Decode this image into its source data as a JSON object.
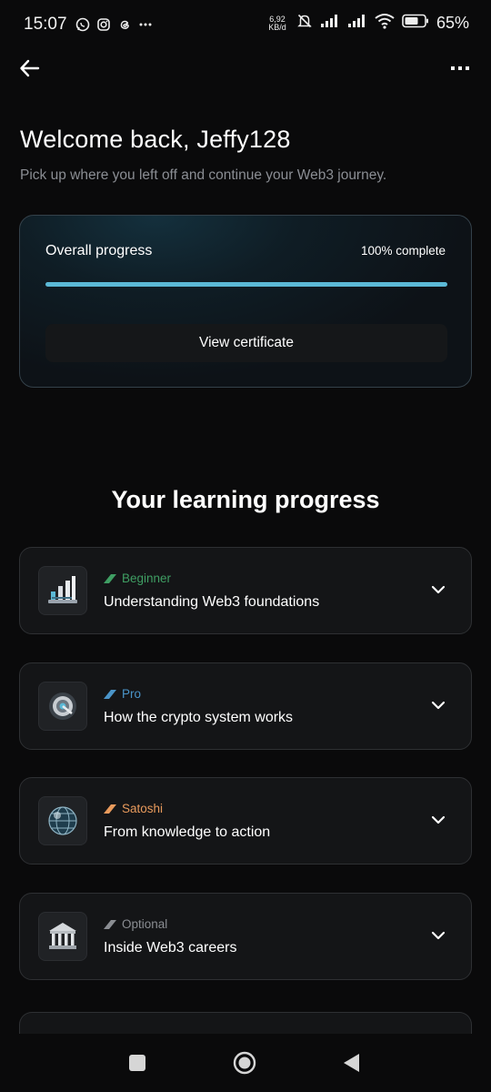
{
  "status_bar": {
    "time": "15:07",
    "net_speed_top": "6,92",
    "net_speed_bottom": "KB/d",
    "battery": "65%",
    "icons": [
      "whatsapp-icon",
      "instagram-icon",
      "threads-icon",
      "more-notifications-icon",
      "mute-bell-icon",
      "signal-icon",
      "signal-icon",
      "wifi-icon",
      "battery-icon"
    ]
  },
  "header": {
    "back_icon": "arrow-left-icon",
    "more_icon": "more-horizontal-icon",
    "welcome": "Welcome back, Jeffy128",
    "subtitle": "Pick up where you left off and continue your Web3 journey."
  },
  "progress": {
    "label": "Overall progress",
    "percent_text": "100% complete",
    "fraction": 1.0,
    "button_label": "View certificate",
    "accent_color": "#5bb9d6"
  },
  "learning": {
    "title": "Your learning progress",
    "modules": [
      {
        "level": "Beginner",
        "level_color": "#3f9e63",
        "title": "Understanding Web3 foundations",
        "icon": "bar-chart-icon"
      },
      {
        "level": "Pro",
        "level_color": "#4a94c8",
        "title": "How the crypto system works",
        "icon": "vault-dial-icon"
      },
      {
        "level": "Satoshi",
        "level_color": "#e89a5c",
        "title": "From knowledge to action",
        "icon": "globe-icon"
      },
      {
        "level": "Optional",
        "level_color": "#8a8d92",
        "title": "Inside Web3 careers",
        "icon": "bank-building-icon"
      }
    ]
  },
  "nav": {
    "icons": [
      "recents-square-icon",
      "home-circle-icon",
      "back-triangle-icon"
    ]
  }
}
